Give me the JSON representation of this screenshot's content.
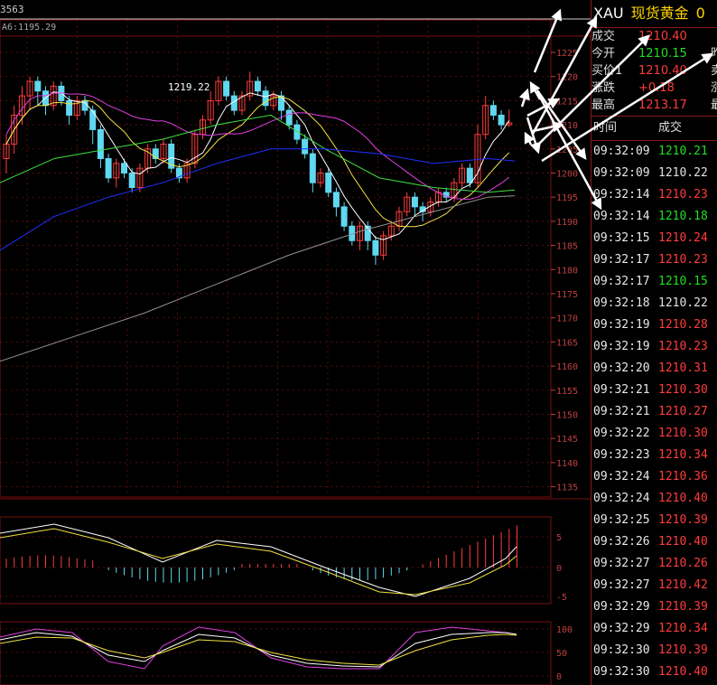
{
  "header": {
    "count": "3563",
    "ma_label": "A6:1195.29"
  },
  "chart": {
    "annotation": "1219.22",
    "price_axis": [
      "1225",
      "1220",
      "1215",
      "1210",
      "1205",
      "1200",
      "1195",
      "1190",
      "1185",
      "1180",
      "1175",
      "1170",
      "1165",
      "1160",
      "1155",
      "1150",
      "1145",
      "1140",
      "1135"
    ],
    "macd_axis": [
      "5",
      "0",
      "-5"
    ],
    "kdj_axis": [
      "100",
      "50",
      "0"
    ],
    "colors": {
      "up": "#ff3b3b",
      "down": "#5fd8f0",
      "ma5": "#ffffff",
      "ma10": "#f0e040",
      "ma20": "#e040e0",
      "ma30": "#40e040",
      "ma60": "#2030ff",
      "ma120": "#909090",
      "grid": "#7a1010"
    }
  },
  "panel": {
    "code": "XAU",
    "name": "现货黄金",
    "extra": "0",
    "quotes": [
      {
        "label": "成交",
        "value": "1210.40",
        "cls": "up",
        "label2": ""
      },
      {
        "label": "今开",
        "value": "1210.15",
        "cls": "dn",
        "label2": "昨"
      },
      {
        "label": "买价1",
        "value": "1210.40",
        "cls": "up",
        "label2": "卖"
      },
      {
        "label": "涨跌",
        "value": "+0.18",
        "cls": "up",
        "label2": "涨"
      },
      {
        "label": "最高",
        "value": "1213.17",
        "cls": "up",
        "label2": "最"
      }
    ],
    "ticks_header": {
      "time": "时间",
      "deal": "成交"
    },
    "ticks": [
      {
        "t": "09:32:09",
        "p": "1210.21",
        "cls": "dn"
      },
      {
        "t": "09:32:09",
        "p": "1210.22",
        "cls": "eq"
      },
      {
        "t": "09:32:14",
        "p": "1210.23",
        "cls": "up"
      },
      {
        "t": "09:32:14",
        "p": "1210.18",
        "cls": "dn"
      },
      {
        "t": "09:32:15",
        "p": "1210.24",
        "cls": "up"
      },
      {
        "t": "09:32:17",
        "p": "1210.23",
        "cls": "up"
      },
      {
        "t": "09:32:17",
        "p": "1210.15",
        "cls": "dn"
      },
      {
        "t": "09:32:18",
        "p": "1210.22",
        "cls": "eq"
      },
      {
        "t": "09:32:19",
        "p": "1210.28",
        "cls": "up"
      },
      {
        "t": "09:32:19",
        "p": "1210.23",
        "cls": "up"
      },
      {
        "t": "09:32:20",
        "p": "1210.31",
        "cls": "up"
      },
      {
        "t": "09:32:21",
        "p": "1210.30",
        "cls": "up"
      },
      {
        "t": "09:32:21",
        "p": "1210.27",
        "cls": "up"
      },
      {
        "t": "09:32:22",
        "p": "1210.30",
        "cls": "up"
      },
      {
        "t": "09:32:23",
        "p": "1210.34",
        "cls": "up"
      },
      {
        "t": "09:32:24",
        "p": "1210.36",
        "cls": "up"
      },
      {
        "t": "09:32:24",
        "p": "1210.40",
        "cls": "up"
      },
      {
        "t": "09:32:25",
        "p": "1210.39",
        "cls": "up"
      },
      {
        "t": "09:32:26",
        "p": "1210.40",
        "cls": "up"
      },
      {
        "t": "09:32:27",
        "p": "1210.26",
        "cls": "up"
      },
      {
        "t": "09:32:27",
        "p": "1210.42",
        "cls": "up"
      },
      {
        "t": "09:32:29",
        "p": "1210.39",
        "cls": "up"
      },
      {
        "t": "09:32:29",
        "p": "1210.34",
        "cls": "up"
      },
      {
        "t": "09:32:30",
        "p": "1210.39",
        "cls": "up"
      },
      {
        "t": "09:32:30",
        "p": "1210.40",
        "cls": "up"
      }
    ]
  }
}
